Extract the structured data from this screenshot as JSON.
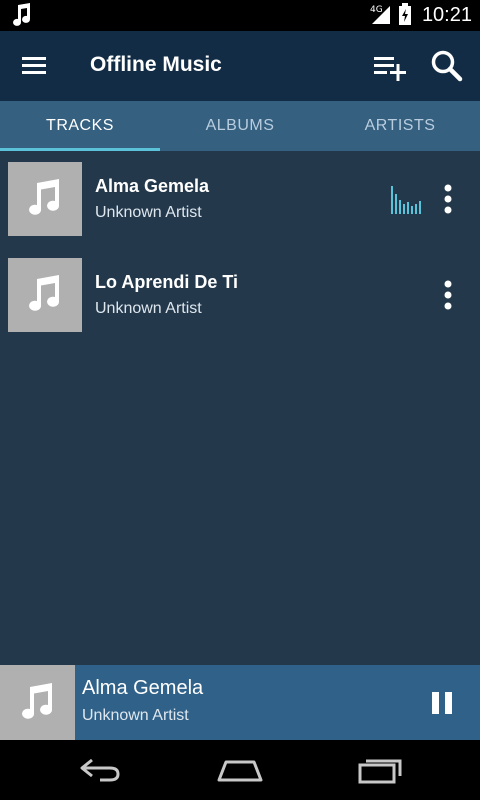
{
  "status_bar": {
    "time": "10:21",
    "network": "4G",
    "notification_icon": "music-note-icon"
  },
  "app_bar": {
    "title": "Offline Music",
    "icons": [
      "menu-icon",
      "add-to-queue-icon",
      "search-icon"
    ]
  },
  "tabs": [
    {
      "label": "TRACKS",
      "active": true
    },
    {
      "label": "ALBUMS",
      "active": false
    },
    {
      "label": "ARTISTS",
      "active": false
    }
  ],
  "tracks": [
    {
      "title": "Alma Gemela",
      "artist": "Unknown Artist",
      "playing": true
    },
    {
      "title": "Lo Aprendi De Ti",
      "artist": "Unknown Artist",
      "playing": false
    }
  ],
  "now_playing": {
    "title": "Alma Gemela",
    "artist": "Unknown Artist",
    "control_icon": "pause-icon"
  },
  "nav_bar": {
    "icons": [
      "back-icon",
      "home-icon",
      "recents-icon"
    ]
  },
  "colors": {
    "background": "#23384b",
    "app_bar": "#122c45",
    "tab_bar": "#35607f",
    "tab_indicator": "#5bc3d9",
    "now_playing_bar": "#2f6189"
  }
}
